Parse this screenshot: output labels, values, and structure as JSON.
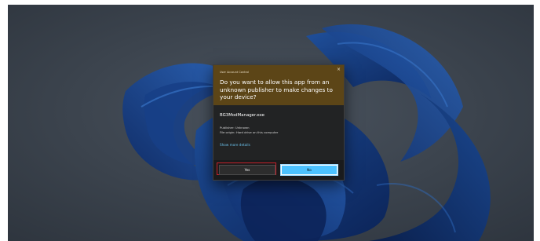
{
  "dialog": {
    "title": "User Account Control",
    "question": "Do you want to allow this app from an unknown publisher to make changes to your device?",
    "app_name": "BG3ModManager.exe",
    "publisher": "Publisher: Unknown",
    "file_origin": "File origin: Hard drive on this computer",
    "more_details_link": "Show more details",
    "close_label": "×",
    "yes_label": "Yes",
    "no_label": "No"
  },
  "colors": {
    "header_bg": "#5c4517",
    "dialog_bg": "#222324",
    "no_button_bg": "#4cc2ff",
    "link": "#6cc3ee",
    "yes_highlight": "#c8202a",
    "desktop_bg": "#3a424d"
  },
  "wallpaper": {
    "name": "windows-11-bloom-wallpaper"
  }
}
